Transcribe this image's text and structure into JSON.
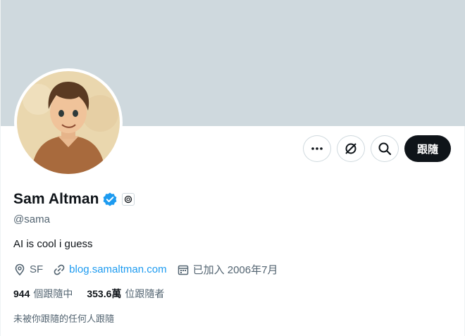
{
  "profile": {
    "name": "Sam Altman",
    "handle": "@sama",
    "bio": "AI is cool i guess",
    "location": "SF",
    "website": "blog.samaltman.com",
    "joined": "已加入 2006年7月"
  },
  "stats": {
    "following_count": "944",
    "following_label": "個跟隨中",
    "followers_count": "353.6萬",
    "followers_label": "位跟隨者"
  },
  "actions": {
    "follow_label": "跟隨",
    "more_icon": "more-icon",
    "grok_icon": "grok-icon",
    "search_icon": "search-icon"
  },
  "followed_by_note": "未被你跟隨的任何人跟隨",
  "colors": {
    "banner": "#cfd9de",
    "verified": "#1d9bf0",
    "link": "#1d9bf0",
    "follow_button": "#0f1419",
    "secondary_text": "#536471"
  }
}
